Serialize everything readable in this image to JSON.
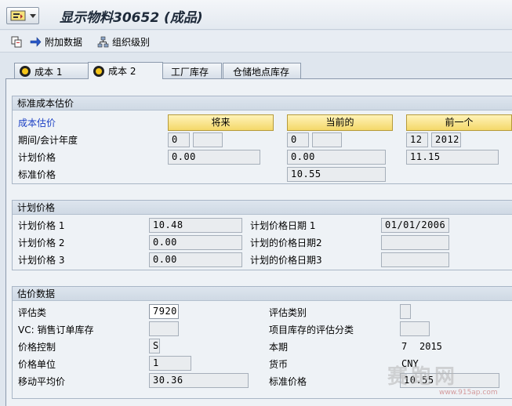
{
  "window": {
    "title": "显示物料30652 (成品)"
  },
  "toolbar": {
    "additional_data": "附加数据",
    "org_levels": "组织级别"
  },
  "tabs": [
    {
      "label": "成本 1"
    },
    {
      "label": "成本 2"
    },
    {
      "label": "工厂库存"
    },
    {
      "label": "仓储地点库存"
    }
  ],
  "standard_cost": {
    "header": "标准成本估价",
    "cost_estimate_label": "成本估价",
    "col_future": "将来",
    "col_current": "当前的",
    "col_previous": "前一个",
    "period_label": "期间/会计年度",
    "planned_price_label": "计划价格",
    "standard_price_label": "标准价格",
    "future": {
      "period": "0",
      "year": "",
      "planned_price": "0.00"
    },
    "current": {
      "period": "0",
      "year": "",
      "planned_price": "0.00",
      "standard_price": "10.55"
    },
    "previous": {
      "period": "12",
      "year": "2012",
      "planned_price": "11.15"
    }
  },
  "planned_prices": {
    "header": "计划价格",
    "price1_label": "计划价格 1",
    "price2_label": "计划价格 2",
    "price3_label": "计划价格 3",
    "price1": "10.48",
    "price2": "0.00",
    "price3": "0.00",
    "date1_label": "计划价格日期 1",
    "date2_label": "计划的价格日期2",
    "date3_label": "计划的价格日期3",
    "date1": "01/01/2006",
    "date2": "",
    "date3": ""
  },
  "valuation": {
    "header": "估价数据",
    "valuation_class_label": "评估类",
    "valuation_class": "7920",
    "vc_sales_order_label": "VC: 销售订单库存",
    "vc_sales_order": "",
    "price_control_label": "价格控制",
    "price_control": "S",
    "price_unit_label": "价格单位",
    "price_unit": "1",
    "moving_avg_label": "移动平均价",
    "moving_avg": "30.36",
    "valuation_category_label": "评估类别",
    "valuation_category": "",
    "project_stock_label": "项目库存的评估分类",
    "project_stock": "",
    "current_period_label": "本期",
    "current_period": "7",
    "current_year": "2015",
    "currency_label": "货币",
    "currency": "CNY",
    "std_price_label": "标准价格",
    "std_price": "10.55"
  },
  "watermark": {
    "text": "赛跑网",
    "url": "www.915ap.com"
  }
}
